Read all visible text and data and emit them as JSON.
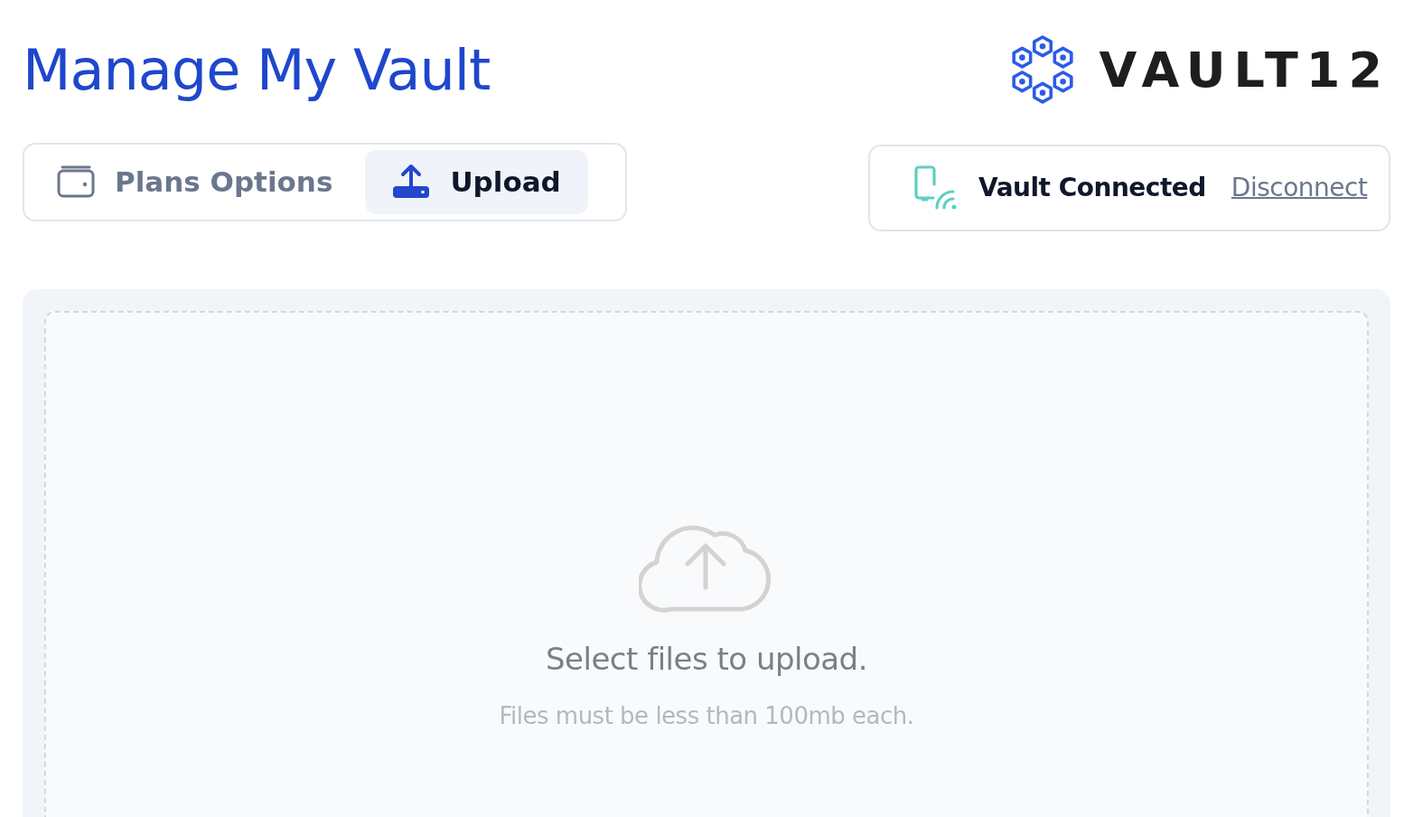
{
  "header": {
    "title": "Manage My Vault",
    "logo_text": "VAULT12"
  },
  "tabs": [
    {
      "label": "Plans Options",
      "kind": "wallet",
      "selected": false
    },
    {
      "label": "Upload",
      "kind": "upload",
      "selected": true
    }
  ],
  "connection": {
    "status": "Vault Connected",
    "action": "Disconnect"
  },
  "dropzone": {
    "title": "Select files to upload.",
    "hint": "Files must be less than 100mb each."
  }
}
